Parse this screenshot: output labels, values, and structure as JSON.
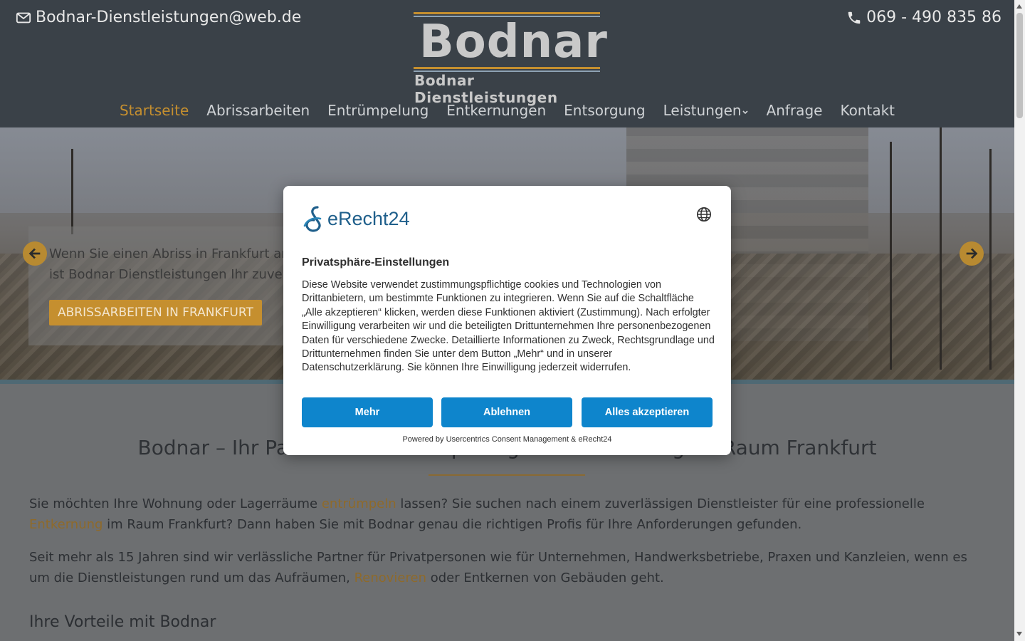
{
  "header": {
    "email": "Bodnar-Dienstleistungen@web.de",
    "phone": "069 - 490 835 86",
    "logo_word": "Bodnar",
    "logo_tagline": "Bodnar Dienstleistungen"
  },
  "nav": {
    "items": [
      {
        "label": "Startseite"
      },
      {
        "label": "Abrissarbeiten"
      },
      {
        "label": "Entrümpelung"
      },
      {
        "label": "Entkernungen"
      },
      {
        "label": "Entsorgung"
      },
      {
        "label": "Leistungen"
      },
      {
        "label": "Anfrage"
      },
      {
        "label": "Kontakt"
      }
    ],
    "active_color": "#c58f2f"
  },
  "hero": {
    "text_line1": "Wenn Sie einen Abriss in Frankfurt am",
    "text_line2": "ist Bodnar Dienstleistungen Ihr zuverlä",
    "button": "ABRISSARBEITEN IN FRANKFURT"
  },
  "content": {
    "heading": "Bodnar – Ihr Partner für Entrümpelung und Entkernung im Raum Frankfurt",
    "p1_a": "Sie möchten Ihre Wohnung oder Lagerräume ",
    "p1_link1": "entrümpeln",
    "p1_b": " lassen? Sie suchen nach einem zuverlässigen Dienstleister für eine professionelle ",
    "p1_link2": "Entkernung",
    "p1_c": " im Raum Frankfurt? Dann haben Sie mit Bodnar genau die richtigen Profis für Ihre Anforderungen gefunden.",
    "p2_a": "Seit mehr als 15 Jahren sind wir verlässliche Partner für Privatpersonen wie für Unternehmen, Handwerksbetriebe, Praxen und Kanzleien, wenn es um die Dienstleistungen rund um das Aufräumen, ",
    "p2_link": "Renovieren",
    "p2_b": " oder Entkernen von Gebäuden geht.",
    "subheading": "Ihre Vorteile mit Bodnar"
  },
  "consent": {
    "brand": "eRecht24",
    "title": "Privatsphäre-Einstellungen",
    "body": "Diese Website verwendet zustimmungspflichtige cookies und Technologien von Drittanbietern, um bestimmte Funktionen zu integrieren. Wenn Sie auf die Schaltfläche „Alle akzeptieren“ klicken, werden diese Funktionen aktiviert (Zustimmung). Nach erfolgter Einwilligung verarbeiten wir und die beteiligten Drittunternehmen Ihre personenbezogenen Daten für verschiedene Zwecke. Detaillierte Informationen zu Zweck, Rechtsgrundlage und Drittunternehmen finden Sie unter dem Button „Mehr“ und in unserer Datenschutzerklärung. Sie können Ihre Einwilligung jederzeit widerrufen.",
    "btn_more": "Mehr",
    "btn_decline": "Ablehnen",
    "btn_accept": "Alles akzeptieren",
    "footer": "Powered by Usercentrics Consent Management & eRecht24",
    "button_color": "#0e85cc"
  }
}
